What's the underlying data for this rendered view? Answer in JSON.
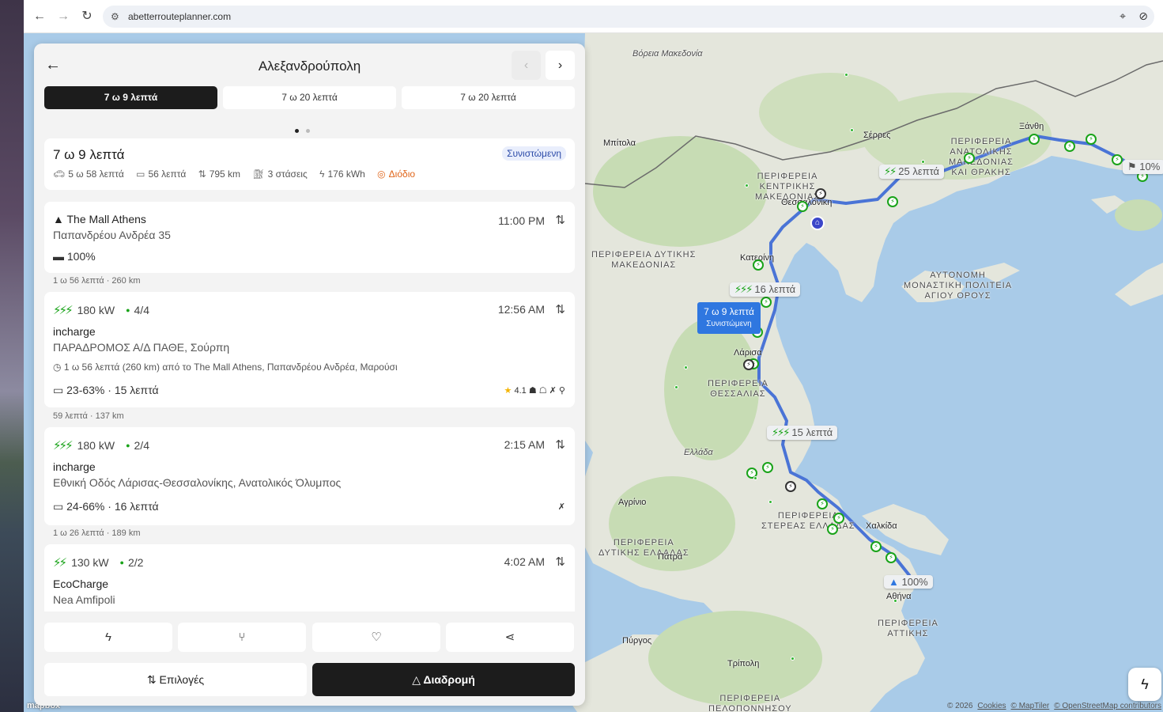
{
  "browser": {
    "url": "abetterrouteplanner.com",
    "icons": [
      "back-arrow",
      "forward-arrow",
      "reload",
      "site-settings",
      "location-pin",
      "eye-slash"
    ]
  },
  "panel": {
    "title": "Αλεξανδρούπολη",
    "tabs": [
      {
        "label": "7 ω 9 λεπτά",
        "active": true
      },
      {
        "label": "7 ω 20 λεπτά",
        "active": false
      },
      {
        "label": "7 ω 20 λεπτά",
        "active": false
      }
    ],
    "summary": {
      "title": "7 ω 9 λεπτά",
      "badge": "Συνιστώμενη",
      "drive": "5 ω 58 λεπτά",
      "charge": "56 λεπτά",
      "distance": "795 km",
      "stops": "3 στάσεις",
      "energy": "176 kWh",
      "toll": "Διόδιο"
    },
    "origin": {
      "name": "The Mall Athens",
      "address": "Παπανδρέου Ανδρέα 35",
      "time": "11:00 PM",
      "battery": "100%"
    },
    "legs": [
      "1 ω 56 λεπτά · 260 km",
      "59 λεπτά · 137 km",
      "1 ω 26 λεπτά · 189 km"
    ],
    "stops": [
      {
        "power": "180 kW",
        "availability": "4/4",
        "time": "12:56 AM",
        "network": "incharge",
        "address": "ΠΑΡΑΔΡΟΜΟΣ Α/Δ ΠΑΘΕ, Σούρπη",
        "meta": "1 ω 56 λεπτά (260 km) από το The Mall Athens, Παπανδρέου Ανδρέα, Μαρούσι",
        "charge": "23-63%",
        "duration": "15 λεπτά",
        "rating": "4.1"
      },
      {
        "power": "180 kW",
        "availability": "2/4",
        "time": "2:15 AM",
        "network": "incharge",
        "address": "Εθνική Οδός Λάρισας-Θεσσαλονίκης, Ανατολικός Όλυμπος",
        "charge": "24-66%",
        "duration": "16 λεπτά"
      },
      {
        "power": "130 kW",
        "availability": "2/2",
        "time": "4:02 AM",
        "network": "EcoCharge",
        "address": "Nea Amfipoli"
      }
    ],
    "actions": {
      "options": "Επιλογές",
      "route": "Διαδρομή"
    }
  },
  "map": {
    "tooltip": {
      "title": "7 ω 9 λεπτά",
      "subtitle": "Συνιστώμενη"
    },
    "chips": [
      "25 λεπτά",
      "16 λεπτά",
      "15 λεπτά"
    ],
    "start_battery": "100%",
    "end_battery": "10%",
    "labels": {
      "vmak": "Βόρεια\nΜακεδονία",
      "bitola": "Μπίτολα",
      "serres": "Σέρρες",
      "xanthi": "Ξάνθη",
      "kentriki": "ΠΕΡΙΦΕΡΕΙΑ\nΚΕΝΤΡΙΚΗΣ\nΜΑΚΕΔΟΝΙΑΣ",
      "thess": "Θεσσαλονίκη",
      "anatoliki": "ΠΕΡΙΦΕΡΕΙΑ\nΑΝΑΤΟΛΙΚΗΣ\nΜΑΚΕΔΟΝΙΑΣ\nΚΑΙ ΘΡΑΚΗΣ",
      "dytiki": "ΠΕΡΙΦΕΡΕΙΑ ΔΥΤΙΚΗΣ\nΜΑΚΕΔΟΝΙΑΣ",
      "katerini": "Κατερίνη",
      "athos": "ΑΥΤΟΝΟΜΗ\nΜΟΝΑΣΤΙΚΗ ΠΟΛΙΤΕΙΑ\nΑΓΙΟΥ ΟΡΟΥΣ",
      "larisa": "Λάρισα",
      "thessalia": "ΠΕΡΙΦΕΡΕΙΑ\nΘΕΣΣΑΛΙΑΣ",
      "ellada": "Ελλάδα",
      "agrinio": "Αγρίνιο",
      "stereas": "ΠΕΡΙΦΕΡΕΙΑ\nΣΤΕΡΕΑΣ ΕΛΛΑΔΑΣ",
      "chalkida": "Χαλκίδα",
      "dytikis_ell": "ΠΕΡΙΦΕΡΕΙΑ\nΔΥΤΙΚΗΣ ΕΛΛΑΔΑΣ",
      "patra": "Πάτρα",
      "athina": "Αθήνα",
      "attiki": "ΠΕΡΙΦΕΡΕΙΑ\nΑΤΤΙΚΗΣ",
      "pyrgos": "Πύργος",
      "tripoli": "Τρίπολη",
      "pelop": "ΠΕΡΙΦΕΡΕΙΑ\nΠΕΛΟΠΟΝΝΗΣΟΥ"
    },
    "attribution": {
      "year": "© 2026",
      "cookies": "Cookies",
      "maptiler": "© MapTiler",
      "osm": "© OpenStreetMap contributors"
    },
    "logo": "mapbox"
  },
  "colors": {
    "accent": "#19a319",
    "route": "#4a74d6",
    "dark": "#1c1c1c"
  }
}
